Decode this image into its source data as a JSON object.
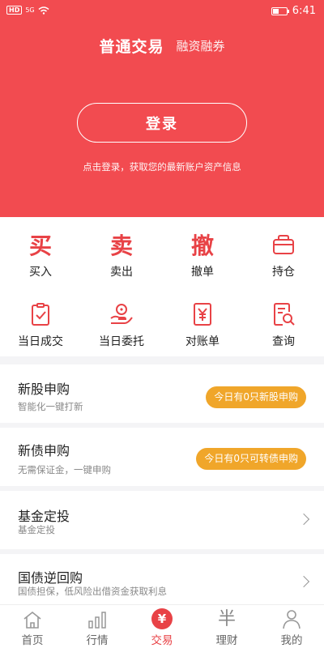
{
  "status_bar": {
    "left_chips": [
      "HD",
      "5G"
    ],
    "time": "6:41"
  },
  "header": {
    "title": "普通交易",
    "subtitle": "融资融券",
    "login_label": "登录",
    "login_hint": "点击登录，获取您的最新账户资产信息"
  },
  "quick_actions": [
    {
      "label": "买入",
      "glyph": "买"
    },
    {
      "label": "卖出",
      "glyph": "卖"
    },
    {
      "label": "撤单",
      "glyph": "撤"
    },
    {
      "label": "持仓",
      "icon": "briefcase-icon"
    },
    {
      "label": "当日成交",
      "icon": "clipboard-check-icon"
    },
    {
      "label": "当日委托",
      "icon": "hand-coin-icon"
    },
    {
      "label": "对账单",
      "icon": "yuan-document-icon"
    },
    {
      "label": "查询",
      "icon": "document-search-icon"
    }
  ],
  "cards": [
    {
      "title": "新股申购",
      "subtitle": "智能化一键打新",
      "badge": "今日有0只新股申购"
    },
    {
      "title": "新债申购",
      "subtitle": "无需保证金，一键申购",
      "badge": "今日有0只可转债申购"
    },
    {
      "title": "基金定投",
      "subtitle": "基金定投"
    },
    {
      "title": "国债逆回购",
      "subtitle": "国债担保，低风险出借资金获取利息"
    }
  ],
  "tabs": [
    {
      "label": "首页",
      "icon": "home-icon"
    },
    {
      "label": "行情",
      "icon": "bar-chart-icon"
    },
    {
      "label": "交易",
      "icon": "yuan-circle-icon",
      "active": true,
      "glyph": "¥"
    },
    {
      "label": "理财",
      "icon": "wealth-icon",
      "glyph": "半"
    },
    {
      "label": "我的",
      "icon": "user-icon"
    }
  ],
  "colors": {
    "brand_red": "#f24b50",
    "accent_red": "#e84246",
    "badge_orange": "#f0a62a"
  }
}
